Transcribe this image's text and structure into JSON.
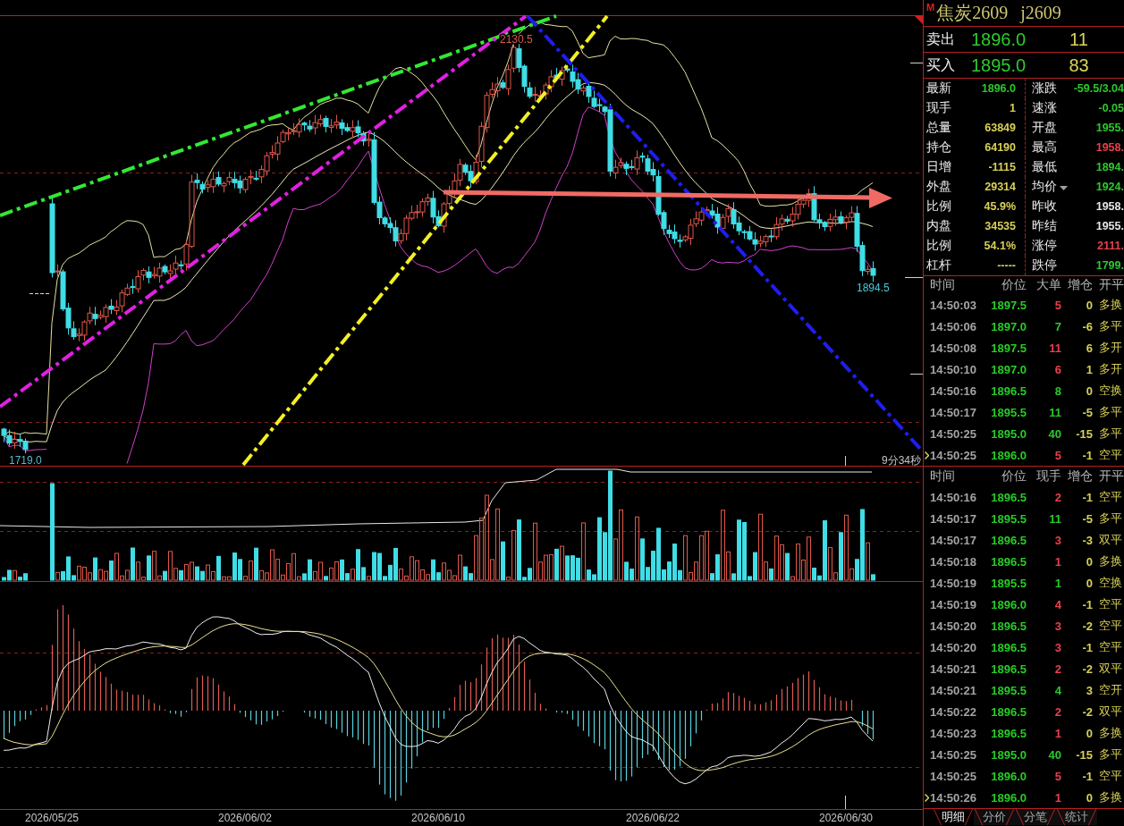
{
  "chart": {
    "price_labels": [
      {
        "kind": "high",
        "text": "2130.5"
      },
      {
        "kind": "low",
        "text": "1719.0"
      },
      {
        "kind": "last",
        "text": "1894.5"
      }
    ],
    "countdown": "9分34秒",
    "dates": [
      "2026/05/25",
      "2026/06/02",
      "2026/06/10",
      "2026/06/22",
      "2026/06/30"
    ]
  },
  "quote": {
    "badge": "M",
    "name": "焦炭2609",
    "code": "j2609",
    "ask": {
      "label": "卖出",
      "price": "1896.0",
      "volume": "11"
    },
    "bid": {
      "label": "买入",
      "price": "1895.0",
      "volume": "83"
    }
  },
  "stats": [
    {
      "left": {
        "label": "最新",
        "value": "1896.0",
        "color": "#2cc82c",
        "dropdown": false
      },
      "right": {
        "label": "涨跌",
        "value": "-59.5/3.04",
        "color": "#2cc82c",
        "dropdown": false
      }
    },
    {
      "left": {
        "label": "现手",
        "value": "1",
        "color": "#d8d058",
        "dropdown": false
      },
      "right": {
        "label": "速涨",
        "value": "-0.05",
        "color": "#2cc82c",
        "dropdown": false
      }
    },
    {
      "left": {
        "label": "总量",
        "value": "63849",
        "color": "#d8d058",
        "dropdown": false
      },
      "right": {
        "label": "开盘",
        "value": "1955.",
        "color": "#2cc82c",
        "dropdown": false
      }
    },
    {
      "left": {
        "label": "持仓",
        "value": "64190",
        "color": "#d8d058",
        "dropdown": false
      },
      "right": {
        "label": "最高",
        "value": "1958.",
        "color": "#e8404c",
        "dropdown": false
      }
    },
    {
      "left": {
        "label": "日增",
        "value": "-1115",
        "color": "#d8d058",
        "dropdown": false
      },
      "right": {
        "label": "最低",
        "value": "1894.",
        "color": "#2cc82c",
        "dropdown": false
      }
    },
    {
      "left": {
        "label": "外盘",
        "value": "29314",
        "color": "#d8d058",
        "dropdown": false
      },
      "right": {
        "label": "均价",
        "value": "1924.",
        "color": "#2cc82c",
        "dropdown": true
      }
    },
    {
      "left": {
        "label": "比例",
        "value": "45.9%",
        "color": "#d8d058",
        "dropdown": false
      },
      "right": {
        "label": "昨收",
        "value": "1958.",
        "color": "#e4e4e4",
        "dropdown": false
      }
    },
    {
      "left": {
        "label": "内盘",
        "value": "34535",
        "color": "#d8d058",
        "dropdown": false
      },
      "right": {
        "label": "昨结",
        "value": "1955.",
        "color": "#e4e4e4",
        "dropdown": false
      }
    },
    {
      "left": {
        "label": "比例",
        "value": "54.1%",
        "color": "#d8d058",
        "dropdown": false
      },
      "right": {
        "label": "涨停",
        "value": "2111.",
        "color": "#e8404c",
        "dropdown": false
      }
    },
    {
      "left": {
        "label": "杠杆",
        "value": "-----",
        "color": "#d8d058",
        "dropdown": false
      },
      "right": {
        "label": "跌停",
        "value": "1799.",
        "color": "#2cc82c",
        "dropdown": false
      }
    }
  ],
  "big_orders": {
    "columns": [
      "时间",
      "价位",
      "大单",
      "增仓",
      "开平"
    ],
    "rows": [
      {
        "time": "14:50:03",
        "price": "1897.5",
        "size": "5",
        "color": "#e8404c",
        "change": "0",
        "type": "多换",
        "selected": false
      },
      {
        "time": "14:50:06",
        "price": "1897.0",
        "size": "7",
        "color": "#2cc82c",
        "change": "-6",
        "type": "多平",
        "selected": false
      },
      {
        "time": "14:50:08",
        "price": "1897.5",
        "size": "11",
        "color": "#e8404c",
        "change": "6",
        "type": "多开",
        "selected": false
      },
      {
        "time": "14:50:10",
        "price": "1897.0",
        "size": "6",
        "color": "#e8404c",
        "change": "1",
        "type": "多开",
        "selected": false
      },
      {
        "time": "14:50:16",
        "price": "1896.5",
        "size": "8",
        "color": "#2cc82c",
        "change": "0",
        "type": "空换",
        "selected": false
      },
      {
        "time": "14:50:17",
        "price": "1895.5",
        "size": "11",
        "color": "#2cc82c",
        "change": "-5",
        "type": "多平",
        "selected": false
      },
      {
        "time": "14:50:25",
        "price": "1895.0",
        "size": "40",
        "color": "#2cc82c",
        "change": "-15",
        "type": "多平",
        "selected": false
      },
      {
        "time": "14:50:25",
        "price": "1896.0",
        "size": "5",
        "color": "#e8404c",
        "change": "-1",
        "type": "空平",
        "selected": true
      }
    ]
  },
  "ticks": {
    "columns": [
      "时间",
      "价位",
      "现手",
      "增仓",
      "开平"
    ],
    "rows": [
      {
        "time": "14:50:16",
        "price": "1896.5",
        "size": "2",
        "color": "#e8404c",
        "change": "-1",
        "type": "空平",
        "selected": false
      },
      {
        "time": "14:50:17",
        "price": "1895.5",
        "size": "11",
        "color": "#2cc82c",
        "change": "-5",
        "type": "多平",
        "selected": false
      },
      {
        "time": "14:50:17",
        "price": "1896.5",
        "size": "3",
        "color": "#e8404c",
        "change": "-3",
        "type": "双平",
        "selected": false
      },
      {
        "time": "14:50:18",
        "price": "1896.5",
        "size": "1",
        "color": "#e8404c",
        "change": "0",
        "type": "多换",
        "selected": false
      },
      {
        "time": "14:50:19",
        "price": "1895.5",
        "size": "1",
        "color": "#2cc82c",
        "change": "0",
        "type": "空换",
        "selected": false
      },
      {
        "time": "14:50:19",
        "price": "1896.0",
        "size": "4",
        "color": "#e8404c",
        "change": "-1",
        "type": "空平",
        "selected": false
      },
      {
        "time": "14:50:20",
        "price": "1896.5",
        "size": "3",
        "color": "#e8404c",
        "change": "-2",
        "type": "空平",
        "selected": false
      },
      {
        "time": "14:50:20",
        "price": "1896.5",
        "size": "3",
        "color": "#e8404c",
        "change": "-1",
        "type": "空平",
        "selected": false
      },
      {
        "time": "14:50:21",
        "price": "1896.5",
        "size": "2",
        "color": "#e8404c",
        "change": "-2",
        "type": "双平",
        "selected": false
      },
      {
        "time": "14:50:21",
        "price": "1895.5",
        "size": "4",
        "color": "#2cc82c",
        "change": "3",
        "type": "空开",
        "selected": false
      },
      {
        "time": "14:50:22",
        "price": "1896.5",
        "size": "2",
        "color": "#e8404c",
        "change": "-2",
        "type": "双平",
        "selected": false
      },
      {
        "time": "14:50:23",
        "price": "1896.5",
        "size": "1",
        "color": "#e8404c",
        "change": "0",
        "type": "多换",
        "selected": false
      },
      {
        "time": "14:50:25",
        "price": "1895.0",
        "size": "40",
        "color": "#2cc82c",
        "change": "-15",
        "type": "多平",
        "selected": false
      },
      {
        "time": "14:50:25",
        "price": "1896.0",
        "size": "5",
        "color": "#e8404c",
        "change": "-1",
        "type": "空平",
        "selected": false
      },
      {
        "time": "14:50:26",
        "price": "1896.0",
        "size": "1",
        "color": "#e8404c",
        "change": "0",
        "type": "多换",
        "selected": true
      }
    ]
  },
  "tabs": [
    {
      "label": "明细",
      "selected": true
    },
    {
      "label": "分价",
      "selected": false
    },
    {
      "label": "分笔",
      "selected": false
    },
    {
      "label": "统计",
      "selected": false
    }
  ]
}
